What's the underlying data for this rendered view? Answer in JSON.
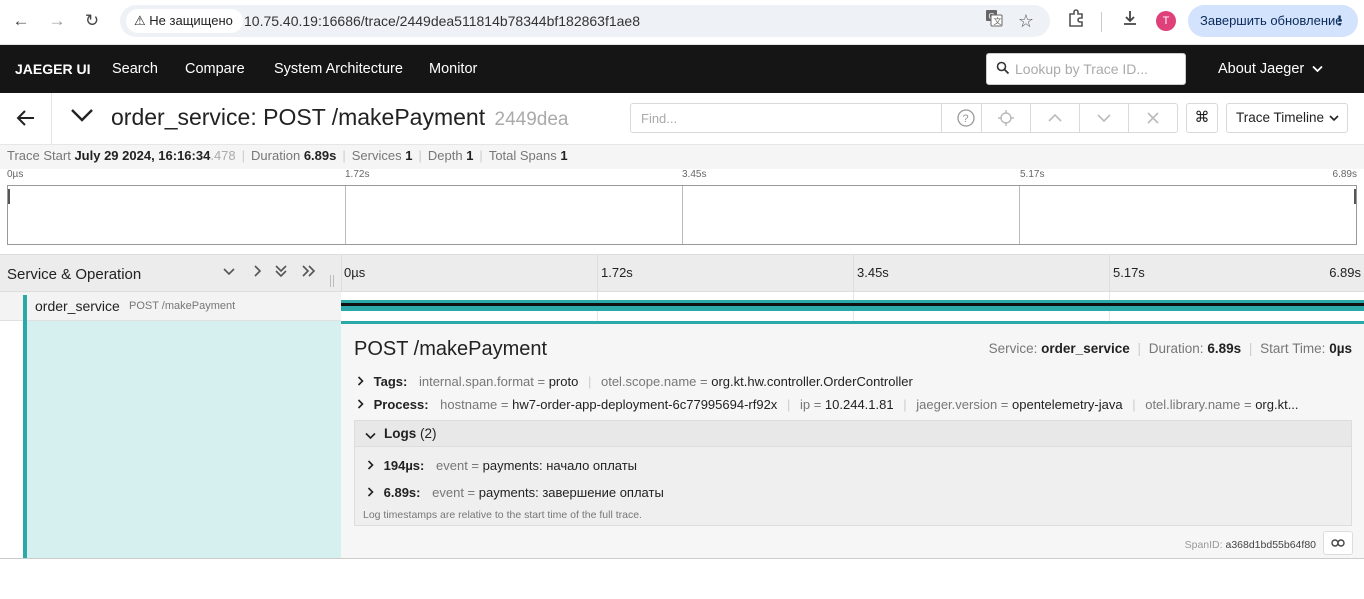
{
  "browser": {
    "security_label": "Не защищено",
    "url": "10.75.40.19:16686/trace/2449dea511814b78344bf182863f1ae8",
    "profile_initial": "T",
    "update_label": "Завершить обновление"
  },
  "nav": {
    "brand": "JAEGER UI",
    "links": [
      "Search",
      "Compare",
      "System Architecture",
      "Monitor"
    ],
    "lookup_placeholder": "Lookup by Trace ID...",
    "about": "About Jaeger"
  },
  "trace": {
    "title": "order_service: POST /makePayment",
    "trace_id_short": "2449dea",
    "find_placeholder": "Find...",
    "view_select": "Trace Timeline"
  },
  "summary": {
    "trace_start_label": "Trace Start",
    "trace_start_value": "July 29 2024, 16:16:34",
    "trace_start_ms": ".478",
    "duration_label": "Duration",
    "duration_value": "6.89s",
    "services_label": "Services",
    "services_value": "1",
    "depth_label": "Depth",
    "depth_value": "1",
    "total_spans_label": "Total Spans",
    "total_spans_value": "1"
  },
  "ticks": [
    "0µs",
    "1.72s",
    "3.45s",
    "5.17s",
    "6.89s"
  ],
  "table": {
    "header": "Service & Operation"
  },
  "span": {
    "service": "order_service",
    "operation": "POST /makePayment",
    "detail_title": "POST /makePayment",
    "service_label": "Service:",
    "service_value": "order_service",
    "duration_label": "Duration:",
    "duration_value": "6.89s",
    "start_label": "Start Time:",
    "start_value": "0µs",
    "tags_label": "Tags:",
    "tags": [
      {
        "key": "internal.span.format",
        "value": "proto"
      },
      {
        "key": "otel.scope.name",
        "value": "org.kt.hw.controller.OrderController"
      }
    ],
    "process_label": "Process:",
    "process": [
      {
        "key": "hostname",
        "value": "hw7-order-app-deployment-6c77995694-rf92x"
      },
      {
        "key": "ip",
        "value": "10.244.1.81"
      },
      {
        "key": "jaeger.version",
        "value": "opentelemetry-java"
      },
      {
        "key": "otel.library.name",
        "value": "org.kt..."
      }
    ],
    "logs_label": "Logs",
    "logs_count": "(2)",
    "logs": [
      {
        "time": "194µs:",
        "key": "event",
        "value": "payments: начало оплаты"
      },
      {
        "time": "6.89s:",
        "key": "event",
        "value": "payments: завершение оплаты"
      }
    ],
    "logs_note": "Log timestamps are relative to the start time of the full trace.",
    "span_id_label": "SpanID:",
    "span_id": "a368d1bd55b64f80"
  },
  "colors": {
    "accent": "#2ba8a8",
    "nav_bg": "#151515",
    "row_bg": "#d6f0f0"
  }
}
